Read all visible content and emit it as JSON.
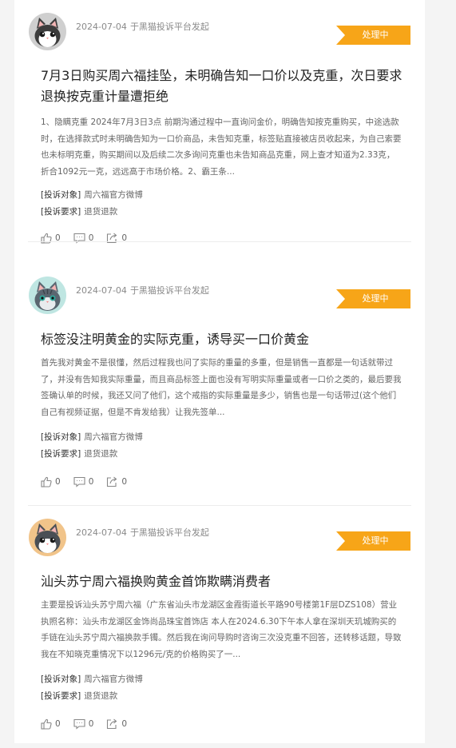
{
  "complaints": [
    {
      "date": "2024-07-04",
      "source": "于黑猫投诉平台发起",
      "status": "处理中",
      "title": "7月3日购买周六福挂坠，未明确告知一口价以及克重，次日要求退换按克重计量遭拒绝",
      "summary": "1、隐瞒克重 2024年7月3日3点 前期沟通过程中一直询问金价，明确告知按克重购买，中途选款时，在选择款式时未明确告知为一口价商品，未告知克重，标签贴直接被店员收起来，为自己索要也未标明克重，购买期间以及后续二次多询问克重也未告知商品克重，网上查才知道为2.33克，折合1092元一克，远远高于市场价格。2、霸王条...",
      "target_label": "[投诉对象]",
      "target": "周六福官方微博",
      "demand_label": "[投诉要求]",
      "demand": "退货退款",
      "likes": "0",
      "comments": "0",
      "shares": "0"
    },
    {
      "date": "2024-07-04",
      "source": "于黑猫投诉平台发起",
      "status": "处理中",
      "title": "标签没注明黄金的实际克重，诱导买一口价黄金",
      "summary": "首先我对黄金不是很懂，然后过程我也问了实际的重量的多重，但是销售一直都是一句话就带过了，并没有告知我实际重量，而且商品标签上面也没有写明实际重量或者一口价之类的，最后要我签确认单的时候，我还又问了他们，这个戒指的实际重量是多少，销售也是一句话带过(这个他们自己有视频证据，但是不肯发给我）让我先签单...",
      "target_label": "[投诉对象]",
      "target": "周六福官方微博",
      "demand_label": "[投诉要求]",
      "demand": "退货退款",
      "likes": "0",
      "comments": "0",
      "shares": "0"
    },
    {
      "date": "2024-07-04",
      "source": "于黑猫投诉平台发起",
      "status": "处理中",
      "title": "汕头苏宁周六福换购黄金首饰欺瞒消费者",
      "summary": "主要是投诉汕头苏宁周六福（广东省汕头市龙湖区金霞街道长平路90号楼第1F层DZS108）营业执照名称：汕头市龙湖区金饰尚品珠宝首饰店 本人在2024.6.30下午本人拿在深圳天玑城购买的手链在汕头苏宁周六福换款手镯。然后我在询问导购时咨询三次没克重不回答，还转移话题，导致我在不知晓克重情况下以1296元/克的价格购买了一...",
      "target_label": "[投诉对象]",
      "target": "周六福官方微博",
      "demand_label": "[投诉要求]",
      "demand": "退货退款",
      "likes": "0",
      "comments": "0",
      "shares": "0"
    }
  ],
  "colors": {
    "badge": "#f7a518",
    "avatars": [
      "#cfcfcf",
      "#bfe6e2",
      "#f1c48a"
    ]
  },
  "icons": {
    "avatar": "cat-avatar-icon",
    "like": "thumbs-up-icon",
    "comment": "comment-icon",
    "share": "share-icon"
  }
}
